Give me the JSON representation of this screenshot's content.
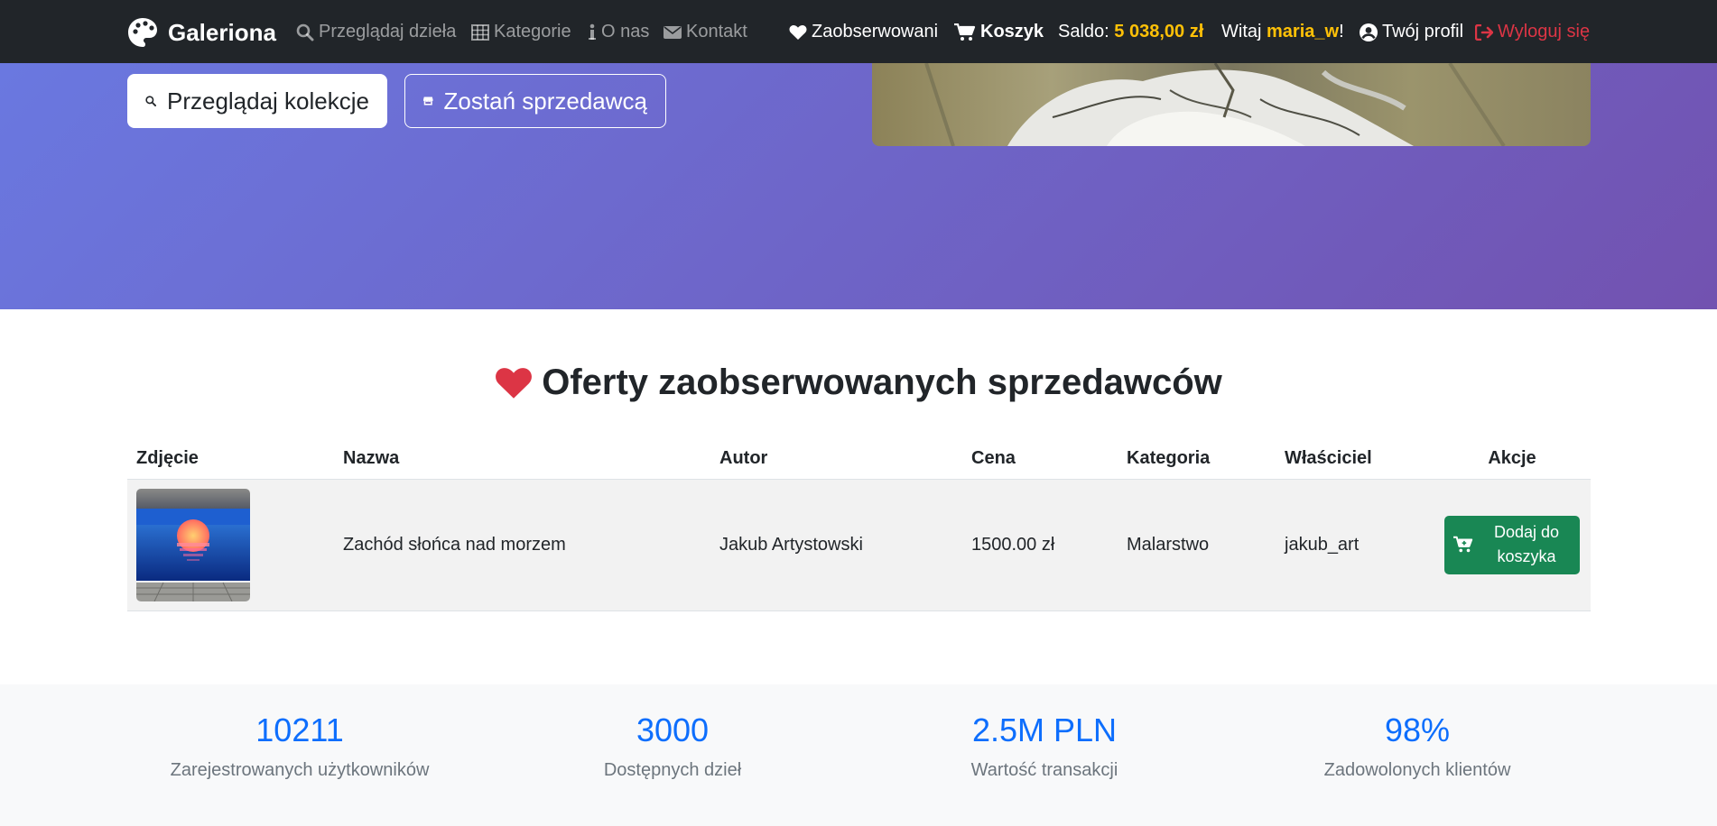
{
  "nav": {
    "brand": "Galeriona",
    "browse": "Przeglądaj dzieła",
    "categories": "Kategorie",
    "about": "O nas",
    "contact": "Kontakt",
    "followed": "Zaobserwowani",
    "cart": "Koszyk",
    "balance_label": "Saldo:",
    "balance_value": "5 038,00 zł",
    "greeting_prefix": "Witaj",
    "username": "maria_w",
    "greeting_suffix": "!",
    "profile": "Twój profil",
    "logout": "Wyloguj się"
  },
  "hero": {
    "browse_collections": "Przeglądaj kolekcje",
    "become_seller": "Zostań sprzedawcą"
  },
  "offers": {
    "title": "Oferty zaobserwowanych sprzedawców",
    "columns": [
      "Zdjęcie",
      "Nazwa",
      "Autor",
      "Cena",
      "Kategoria",
      "Właściciel",
      "Akcje"
    ],
    "rows": [
      {
        "name": "Zachód słońca nad morzem",
        "author": "Jakub Artystowski",
        "price": "1500.00 zł",
        "category": "Malarstwo",
        "owner": "jakub_art",
        "action": "Dodaj do koszyka"
      }
    ]
  },
  "stats": [
    {
      "value": "10211",
      "label": "Zarejestrowanych użytkowników"
    },
    {
      "value": "3000",
      "label": "Dostępnych dzieł"
    },
    {
      "value": "2.5M PLN",
      "label": "Wartość transakcji"
    },
    {
      "value": "98%",
      "label": "Zadowolonych klientów"
    }
  ],
  "colors": {
    "navbar": "#212529",
    "accent_yellow": "#ffc107",
    "logout_red": "#dc3545",
    "heart_red": "#dc3545",
    "stat_blue": "#0d6efd",
    "cart_green": "#198754",
    "hero_gradient_start": "#6a78e0",
    "hero_gradient_end": "#7252b0"
  },
  "icons": [
    "palette-icon",
    "search-icon",
    "table-icon",
    "info-icon",
    "envelope-icon",
    "heart-icon",
    "cart-icon",
    "user-circle-icon",
    "logout-icon",
    "store-icon",
    "cart-plus-icon"
  ]
}
